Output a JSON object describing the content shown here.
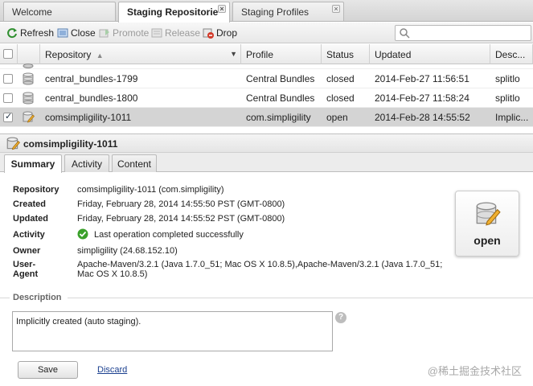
{
  "tabs": [
    {
      "label": "Welcome",
      "closable": false
    },
    {
      "label": "Staging Repositorie",
      "closable": true,
      "active": true
    },
    {
      "label": "Staging Profiles",
      "closable": true
    }
  ],
  "toolbar": {
    "refresh": "Refresh",
    "close": "Close",
    "promote": "Promote",
    "release": "Release",
    "drop": "Drop",
    "search_placeholder": ""
  },
  "grid": {
    "columns": [
      "Repository",
      "Profile",
      "Status",
      "Updated",
      "Desc..."
    ],
    "rows": [
      {
        "repository": "central_bundles-1799",
        "profile": "Central Bundles",
        "status": "closed",
        "updated": "2014-Feb-27 11:56:51",
        "desc": "splitlo",
        "checked": false,
        "selected": false
      },
      {
        "repository": "central_bundles-1800",
        "profile": "Central Bundles",
        "status": "closed",
        "updated": "2014-Feb-27 11:58:24",
        "desc": "splitlo",
        "checked": false,
        "selected": false
      },
      {
        "repository": "comsimpligility-1011",
        "profile": "com.simpligility",
        "status": "open",
        "updated": "2014-Feb-28 14:55:52",
        "desc": "Implic...",
        "checked": true,
        "selected": true
      }
    ]
  },
  "detail": {
    "title": "comsimpligility-1011",
    "tabs": [
      "Summary",
      "Activity",
      "Content"
    ],
    "fields": {
      "repository_label": "Repository",
      "repository_value": "comsimpligility-1011 (com.simpligility)",
      "created_label": "Created",
      "created_value": "Friday, February 28, 2014 14:55:50 PST (GMT-0800)",
      "updated_label": "Updated",
      "updated_value": "Friday, February 28, 2014 14:55:52 PST (GMT-0800)",
      "activity_label": "Activity",
      "activity_value": "Last operation completed successfully",
      "owner_label": "Owner",
      "owner_value": "simpligility (24.68.152.10)",
      "user_agent_label_1": "User-",
      "user_agent_label_2": "Agent",
      "user_agent_line_1": "Apache-Maven/3.2.1 (Java 1.7.0_51; Mac OS X 10.8.5),Apache-Maven/3.2.1 (Java 1.7.0_51;",
      "user_agent_line_2": "Mac OS X 10.8.5)"
    },
    "status_badge": "open",
    "description_legend": "Description",
    "description_value": "Implicitly created (auto staging).",
    "save": "Save",
    "discard": "Discard"
  },
  "watermark": "@稀土掘金技术社区",
  "colors": {
    "link": "#1a3f8f",
    "success": "#3aa02a",
    "selected_row": "#d4d4d4"
  }
}
